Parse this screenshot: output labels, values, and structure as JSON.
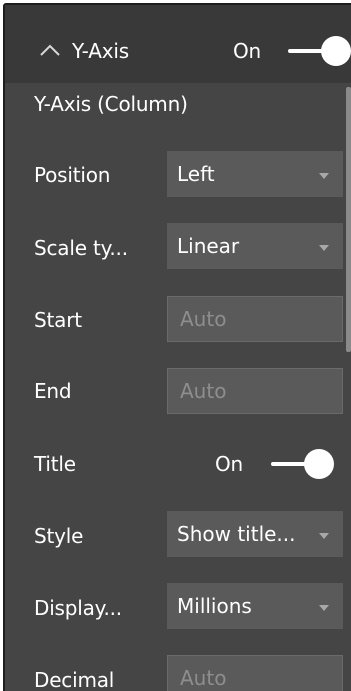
{
  "header": {
    "title": "Y-Axis",
    "toggle_label": "On",
    "toggle_on": true,
    "collapse_icon": "chevron-up-icon"
  },
  "section": {
    "subheader": "Y-Axis (Column)"
  },
  "rows": {
    "position": {
      "label": "Position",
      "value": "Left"
    },
    "scale_type": {
      "label": "Scale ty...",
      "value": "Linear"
    },
    "start": {
      "label": "Start",
      "placeholder": "Auto"
    },
    "end": {
      "label": "End",
      "placeholder": "Auto"
    },
    "title": {
      "label": "Title",
      "toggle_label": "On",
      "toggle_on": true
    },
    "style": {
      "label": "Style",
      "value": "Show title..."
    },
    "display_units": {
      "label": "Display...",
      "value": "Millions"
    },
    "decimal_places": {
      "label": "Decimal",
      "placeholder": "Auto"
    }
  },
  "colors": {
    "header_bg": "#393939",
    "panel_bg": "#454545",
    "control_bg": "#5a5a5a",
    "text": "#ffffff",
    "placeholder": "#8e8e8e"
  }
}
